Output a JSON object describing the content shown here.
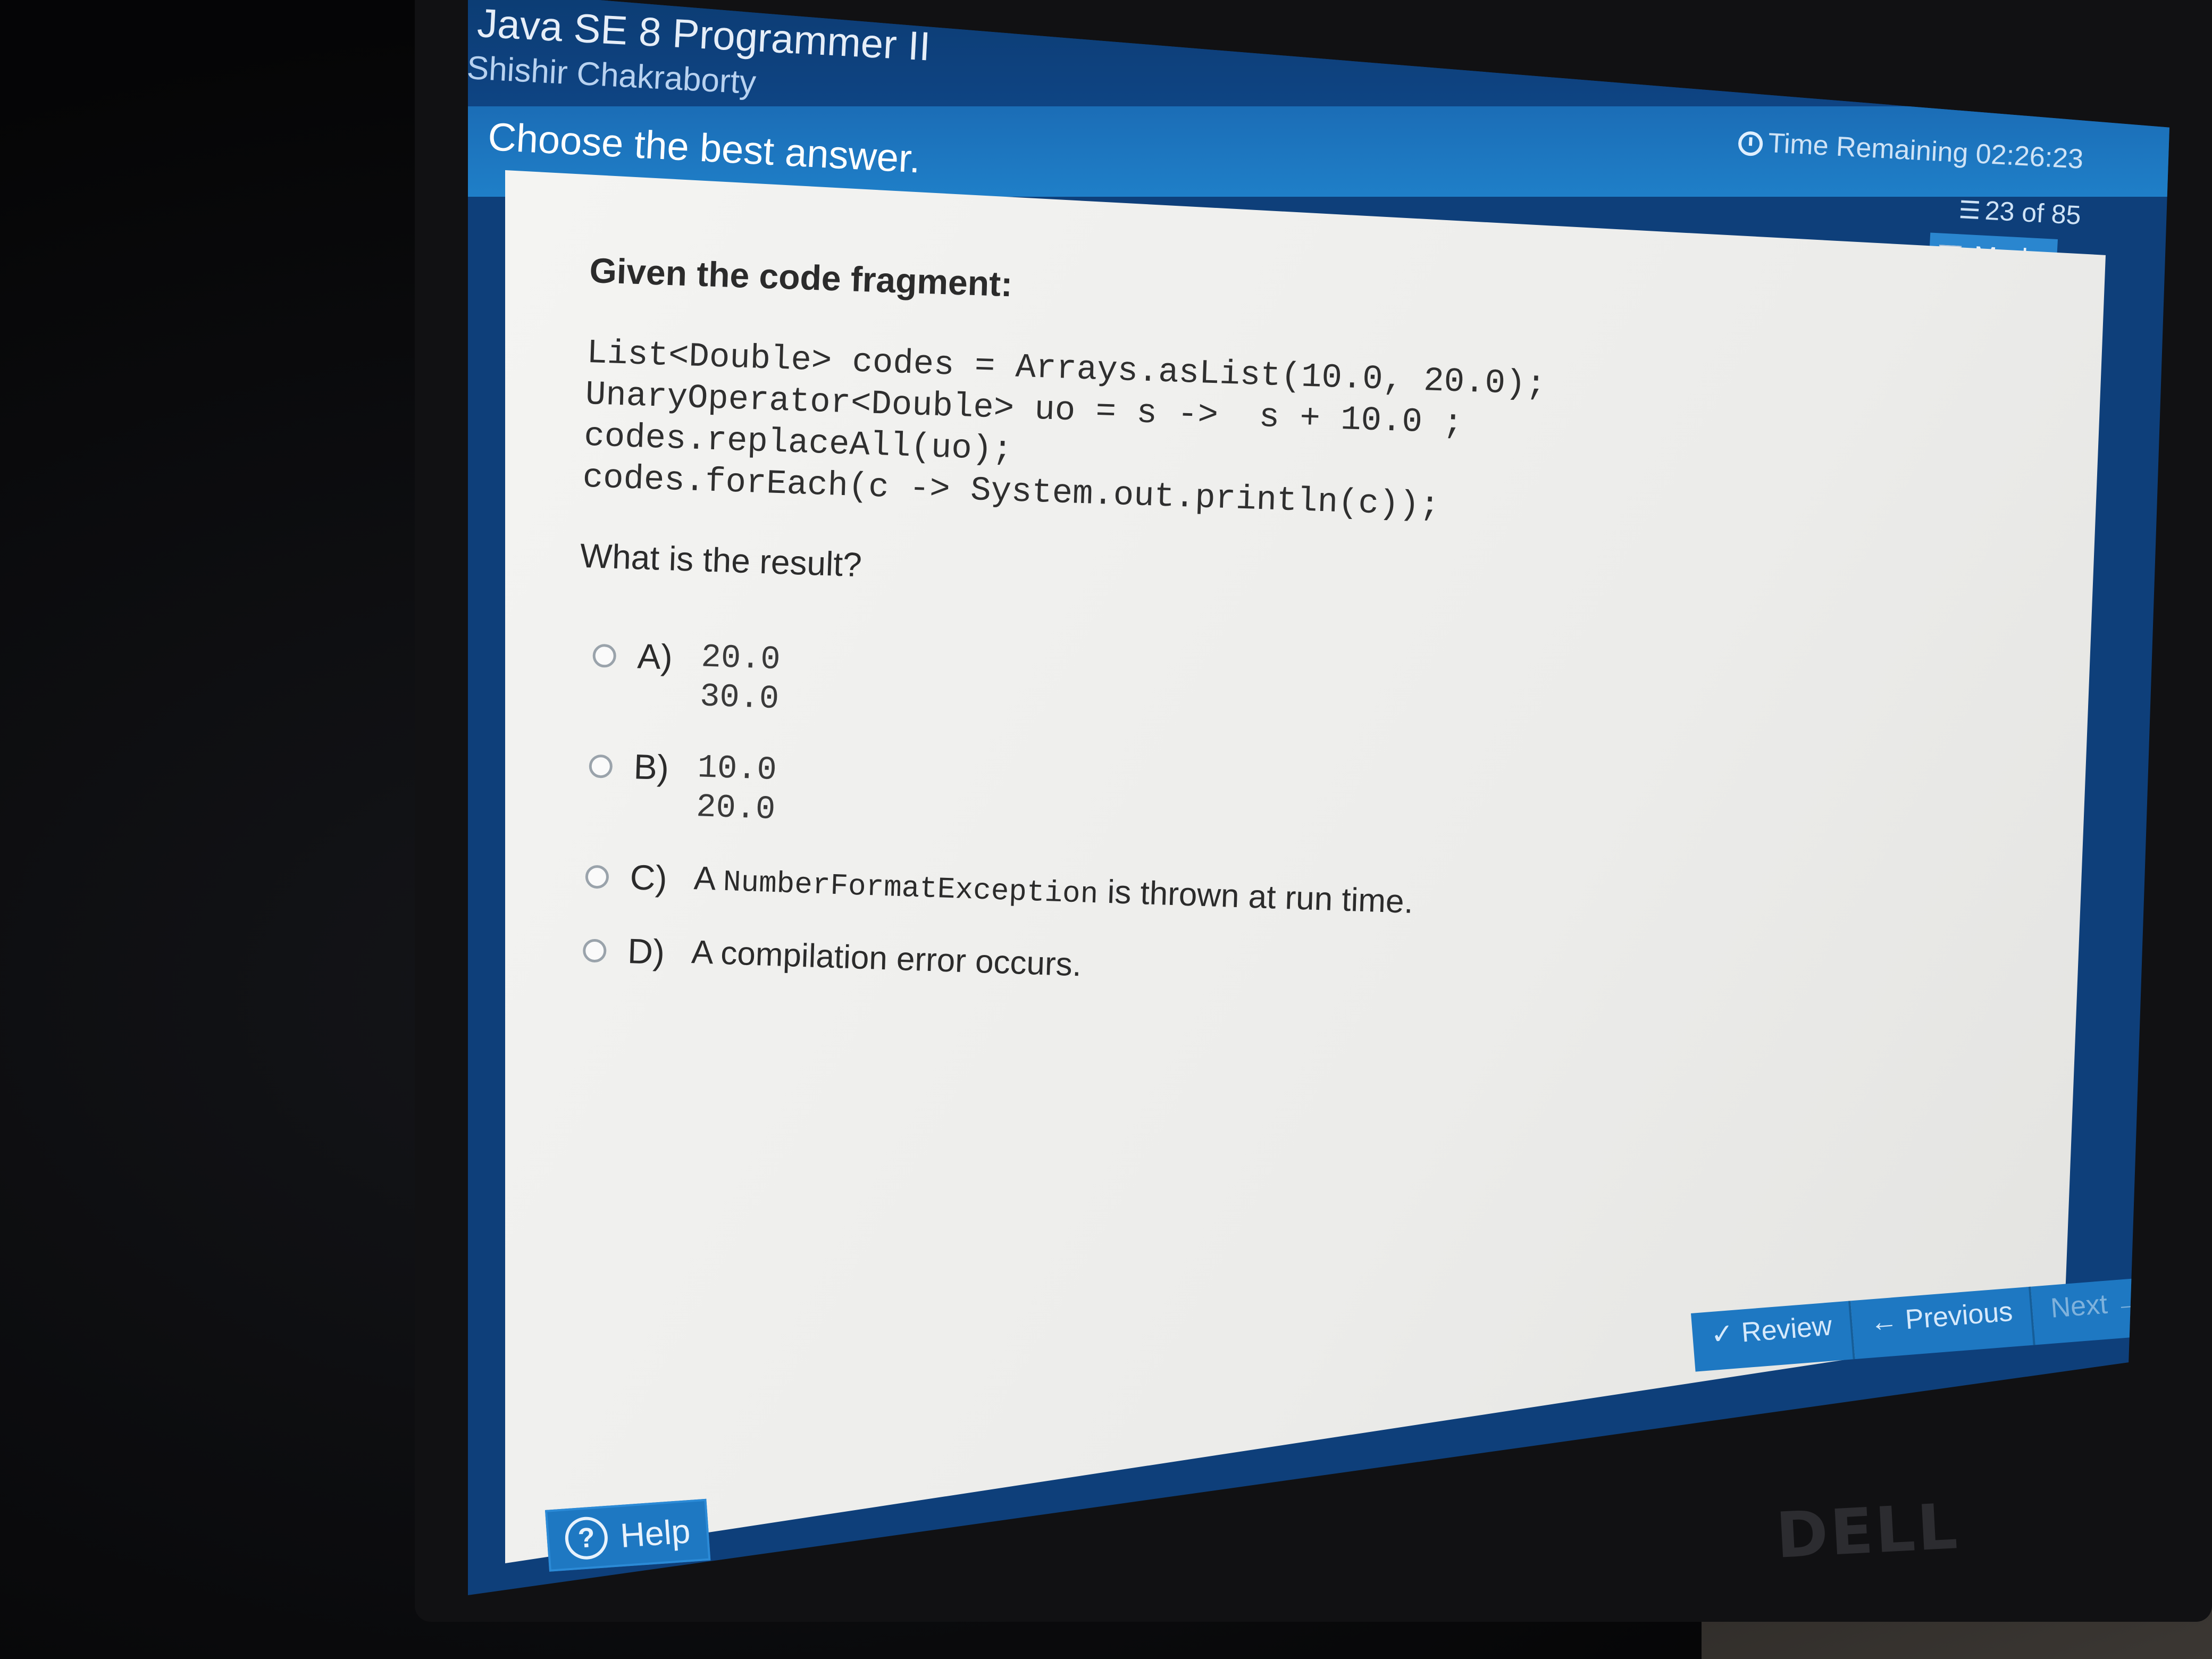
{
  "app": {
    "title": "Java SE 8 Programmer II",
    "candidate": "Shishir Chakraborty"
  },
  "instruction": "Choose the best answer.",
  "status": {
    "time_label": "Time Remaining 02:26:23",
    "progress": "23 of 85",
    "mark_label": "Mark",
    "icons": [
      "clock-icon",
      "list-icon"
    ]
  },
  "question": {
    "prompt": "Given the code fragment:",
    "code": "List<Double> codes = Arrays.asList(10.0, 20.0);\nUnaryOperator<Double> uo = s ->  s + 10.0 ;\ncodes.replaceAll(uo);\ncodes.forEach(c -> System.out.println(c));",
    "ask": "What is the result?",
    "options": [
      {
        "letter": "A)",
        "text": "20.0\n30.0"
      },
      {
        "letter": "B)",
        "text": "10.0\n20.0"
      },
      {
        "letter": "C)",
        "prefix": "A ",
        "code": "NumberFormatException",
        "suffix": " is thrown at run time."
      },
      {
        "letter": "D)",
        "text": "A compilation error occurs."
      }
    ]
  },
  "navigation": {
    "review": "✓ Review",
    "previous": "← Previous",
    "next": "Next →"
  },
  "help": {
    "label": "Help"
  },
  "monitor": {
    "brand": "DELL"
  }
}
